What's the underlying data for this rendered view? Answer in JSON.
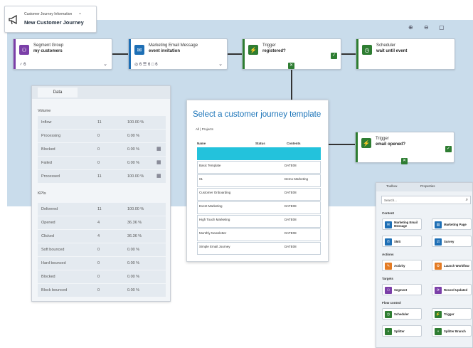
{
  "header": {
    "caption": "Customer Journey Information",
    "chevron": "⌄",
    "title": "New Customer Journey",
    "icon": "megaphone-icon"
  },
  "canvas_icons": [
    "zoom-in-icon",
    "zoom-out-icon",
    "fit-screen-icon"
  ],
  "tiles": {
    "segment_group": {
      "label": "Segment Group",
      "value": "my customers",
      "footer": "♂ 6"
    },
    "marketing_email": {
      "label": "Marketing Email Message",
      "value": "event invitation",
      "footer": "◎ 6 ☰ 6 □ 6"
    },
    "trigger1": {
      "label": "Trigger",
      "value": "registered?"
    },
    "scheduler": {
      "label": "Scheduler",
      "value": "wait until event"
    },
    "trigger2": {
      "label": "Trigger",
      "value": "email opened?"
    }
  },
  "data_panel": {
    "tab": "Data",
    "volume_label": "Volume",
    "volume_rows": [
      {
        "name": "Inflow",
        "count": "11",
        "pct": "100.00 %",
        "icon": ""
      },
      {
        "name": "Processing",
        "count": "0",
        "pct": "0.00 %",
        "icon": ""
      },
      {
        "name": "Blocked",
        "count": "0",
        "pct": "0.00 %",
        "icon": "▦"
      },
      {
        "name": "Failed",
        "count": "0",
        "pct": "0.00 %",
        "icon": "▦"
      },
      {
        "name": "Processed",
        "count": "11",
        "pct": "100.00 %",
        "icon": "▦"
      }
    ],
    "kpi_label": "KPIs",
    "kpi_rows": [
      {
        "name": "Delivered",
        "count": "11",
        "pct": "100.00 %"
      },
      {
        "name": "Opened",
        "count": "4",
        "pct": "36.36 %"
      },
      {
        "name": "Clicked",
        "count": "4",
        "pct": "36.36 %"
      },
      {
        "name": "Soft bounced",
        "count": "0",
        "pct": "0.00 %"
      },
      {
        "name": "Hard bounced",
        "count": "0",
        "pct": "0.00 %"
      },
      {
        "name": "Blocked",
        "count": "0",
        "pct": "0.00 %"
      },
      {
        "name": "Block bounced",
        "count": "0",
        "pct": "0.00 %"
      }
    ]
  },
  "template_dialog": {
    "title": "Select a customer journey template",
    "filter": "All | Projects",
    "col_name": "Name",
    "col_status": "Status",
    "col_contents": "Contents",
    "rows": [
      {
        "name": "",
        "contents": ""
      },
      {
        "name": "Basic Template",
        "contents": "DATE08"
      },
      {
        "name": "01",
        "contents": "Demo Marketing"
      },
      {
        "name": "Customer Onboarding",
        "contents": "DATE08"
      },
      {
        "name": "Event Marketing",
        "contents": "DATE08"
      },
      {
        "name": "High Touch Marketing",
        "contents": "DATE08"
      },
      {
        "name": "Monthly Newsletter",
        "contents": "DATE08"
      },
      {
        "name": "Simple Email Journey",
        "contents": "DATE08"
      }
    ]
  },
  "toolbox": {
    "tab_toolbox": "Toolbox",
    "tab_properties": "Properties",
    "search_placeholder": "Search...",
    "categories": {
      "content": "Content",
      "actions": "Actions",
      "targets": "Targets",
      "flow": "Flow control"
    },
    "items": {
      "marketing_email": "Marketing Email Message",
      "marketing_page": "Marketing Page",
      "sms": "SMS",
      "survey": "Survey",
      "activity": "Activity",
      "launch_workflow": "Launch Workflow",
      "segment": "Segment",
      "record_updated": "Record Updated",
      "scheduler": "Scheduler",
      "trigger": "Trigger",
      "splitter": "Splitter",
      "splitter_branch": "Splitter Branch"
    }
  },
  "colors": {
    "canvas": "#c9dceb",
    "purple": "#7b3fa8",
    "blue": "#1e6fb5",
    "green": "#2e7d32",
    "orange": "#e47b23",
    "selected": "#23c2dc",
    "title_blue": "#1a73b8"
  }
}
